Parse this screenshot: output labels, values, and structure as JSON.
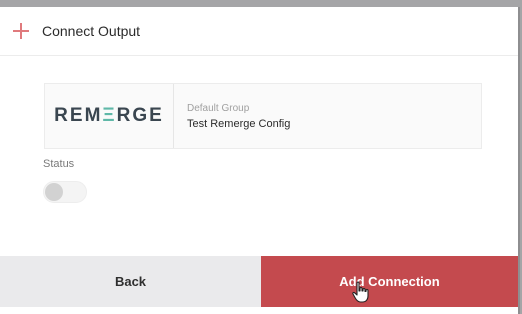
{
  "header": {
    "icon": "plus-icon",
    "title": "Connect Output",
    "accent_color": "#e07a7d"
  },
  "connection": {
    "logo_text_part1": "REM",
    "logo_text_mark": "Ξ",
    "logo_text_part2": "RGE",
    "group": "Default Group",
    "config": "Test Remerge Config"
  },
  "status": {
    "label": "Status",
    "enabled": false
  },
  "footer": {
    "back_label": "Back",
    "add_label": "Add Connection",
    "add_color": "#c44a4e"
  },
  "cursor": {
    "icon": "hand-pointer-icon"
  }
}
